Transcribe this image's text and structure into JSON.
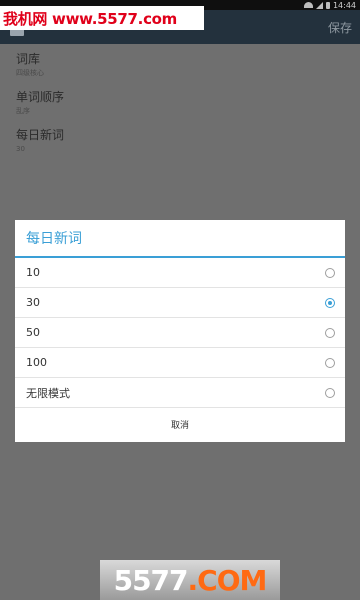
{
  "status_bar": {
    "time": "14:44"
  },
  "action_bar": {
    "save_label": "保存"
  },
  "settings": [
    {
      "title": "词库",
      "subtitle": "四级核心"
    },
    {
      "title": "单词顺序",
      "subtitle": "乱序"
    },
    {
      "title": "每日新词",
      "subtitle": "30"
    }
  ],
  "dialog": {
    "title": "每日新词",
    "options": [
      {
        "label": "10",
        "checked": false
      },
      {
        "label": "30",
        "checked": true
      },
      {
        "label": "50",
        "checked": false
      },
      {
        "label": "100",
        "checked": false
      },
      {
        "label": "无限模式",
        "checked": false
      }
    ],
    "cancel_label": "取消"
  },
  "watermark": {
    "top_text": "我机网 www.5577.com",
    "bottom_text_part1": "5577",
    "bottom_text_part2": ".COM"
  },
  "colors": {
    "accent": "#3a9fd6",
    "watermark_red": "#e0001a",
    "watermark_orange": "#ff6a13"
  }
}
